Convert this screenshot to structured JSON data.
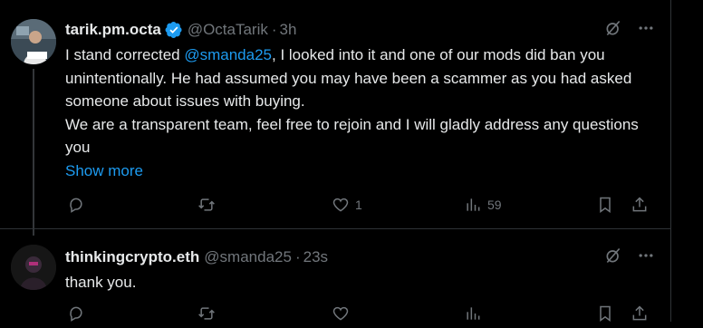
{
  "colors": {
    "background": "#000000",
    "text": "#e7e9ea",
    "muted": "#71767b",
    "link": "#1d9bf0",
    "border": "#2f3336"
  },
  "tweets": [
    {
      "name": "tarik.pm.octa",
      "handle": "@OctaTarik",
      "separator": "·",
      "time": "3h",
      "verified": true,
      "text_segments": [
        {
          "text": "I stand corrected "
        },
        {
          "text": "@smanda25"
        },
        {
          "text": ", I looked into it and one of our mods did ban you unintentionally.  He had assumed you may have been a scammer as you had asked someone about issues with buying."
        },
        {
          "text": "We are a transparent team, feel free to rejoin and I will gladly address any questions you"
        }
      ],
      "show_more": "Show more",
      "likes": "1",
      "views": "59",
      "icons": [
        "grok-icon",
        "more-icon",
        "reply-icon",
        "retweet-icon",
        "like-icon",
        "views-icon",
        "bookmark-icon",
        "share-icon"
      ]
    },
    {
      "name": "thinkingcrypto.eth",
      "handle": "@smanda25",
      "separator": "·",
      "time": "23s",
      "text": "thank you.",
      "icons": [
        "grok-icon",
        "more-icon",
        "reply-icon",
        "retweet-icon",
        "like-icon",
        "views-icon",
        "bookmark-icon",
        "share-icon"
      ]
    }
  ]
}
